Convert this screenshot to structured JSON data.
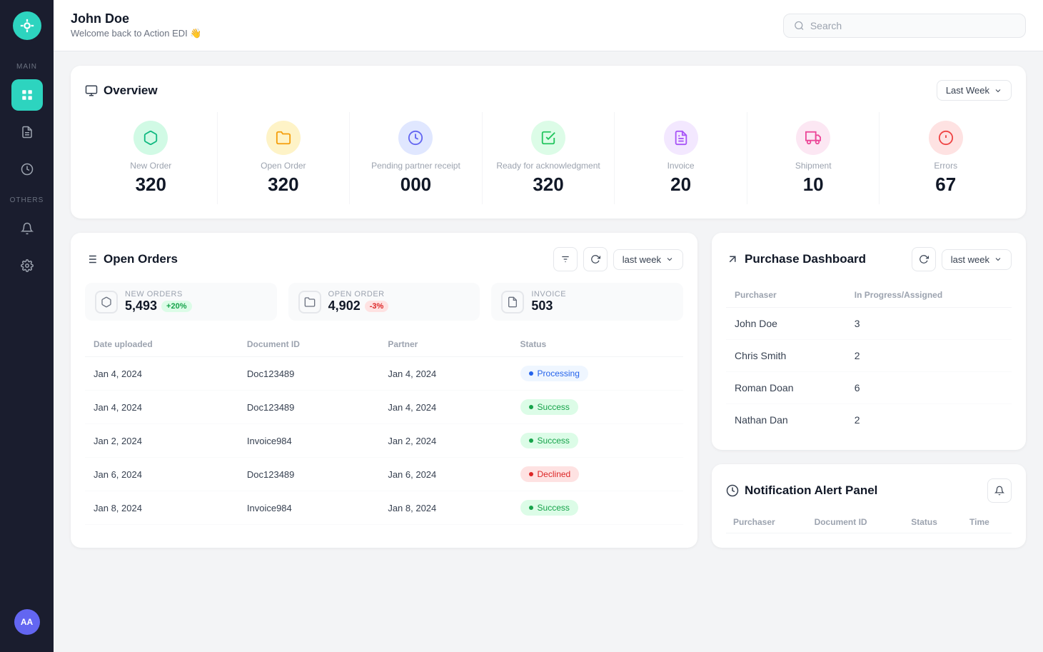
{
  "sidebar": {
    "logo_initials": "AA",
    "sections": {
      "main_label": "MAIN",
      "others_label": "OTHERS"
    },
    "items": [
      {
        "id": "dashboard",
        "label": "Dashboard",
        "active": true
      },
      {
        "id": "documents",
        "label": "Documents",
        "active": false
      },
      {
        "id": "activity",
        "label": "Activity",
        "active": false
      },
      {
        "id": "notifications",
        "label": "Notifications",
        "active": false
      },
      {
        "id": "settings",
        "label": "Settings",
        "active": false
      }
    ]
  },
  "header": {
    "user_name": "John Doe",
    "welcome_message": "Welcome back to Action EDI 👋",
    "search_placeholder": "Search"
  },
  "overview": {
    "title": "Overview",
    "period_label": "Last Week",
    "stats": [
      {
        "id": "new-order",
        "label": "New Order",
        "value": "320",
        "icon_color": "#d1fae5",
        "icon_fg": "#10b981"
      },
      {
        "id": "open-order",
        "label": "Open Order",
        "value": "320",
        "icon_color": "#fef3c7",
        "icon_fg": "#f59e0b"
      },
      {
        "id": "pending-partner",
        "label": "Pending partner receipt",
        "value": "000",
        "icon_color": "#e0e7ff",
        "icon_fg": "#6366f1"
      },
      {
        "id": "ready-ack",
        "label": "Ready for acknowledgment",
        "value": "320",
        "icon_color": "#dcfce7",
        "icon_fg": "#22c55e"
      },
      {
        "id": "invoice",
        "label": "Invoice",
        "value": "20",
        "icon_color": "#f3e8ff",
        "icon_fg": "#a855f7"
      },
      {
        "id": "shipment",
        "label": "Shipment",
        "value": "10",
        "icon_color": "#fce7f3",
        "icon_fg": "#ec4899"
      },
      {
        "id": "errors",
        "label": "Errors",
        "value": "67",
        "icon_color": "#fee2e2",
        "icon_fg": "#ef4444"
      }
    ]
  },
  "open_orders": {
    "title": "Open Orders",
    "period_label": "last week",
    "metrics": [
      {
        "label": "NEW ORDERS",
        "value": "5,493",
        "badge": "+20%",
        "badge_type": "green"
      },
      {
        "label": "OPEN ORDER",
        "value": "4,902",
        "badge": "-3%",
        "badge_type": "red"
      },
      {
        "label": "INVOICE",
        "value": "503"
      }
    ],
    "table": {
      "columns": [
        "Date uploaded",
        "Document ID",
        "Partner",
        "Status"
      ],
      "rows": [
        {
          "date": "Jan 4, 2024",
          "doc_id": "Doc123489",
          "partner": "Jan 4, 2024",
          "status": "Processing",
          "status_type": "processing"
        },
        {
          "date": "Jan 4, 2024",
          "doc_id": "Doc123489",
          "partner": "Jan 4, 2024",
          "status": "Success",
          "status_type": "success"
        },
        {
          "date": "Jan 2, 2024",
          "doc_id": "Invoice984",
          "partner": "Jan 2, 2024",
          "status": "Success",
          "status_type": "success"
        },
        {
          "date": "Jan 6, 2024",
          "doc_id": "Doc123489",
          "partner": "Jan 6, 2024",
          "status": "Declined",
          "status_type": "declined"
        },
        {
          "date": "Jan 8, 2024",
          "doc_id": "Invoice984",
          "partner": "Jan 8, 2024",
          "status": "Success",
          "status_type": "success"
        }
      ]
    }
  },
  "purchase_dashboard": {
    "title": "Purchase Dashboard",
    "period_label": "last week",
    "columns": [
      "Purchaser",
      "In Progress/Assigned"
    ],
    "rows": [
      {
        "purchaser": "John Doe",
        "count": "3"
      },
      {
        "purchaser": "Chris Smith",
        "count": "2"
      },
      {
        "purchaser": "Roman Doan",
        "count": "6"
      },
      {
        "purchaser": "Nathan Dan",
        "count": "2"
      }
    ]
  },
  "notification_panel": {
    "title": "Notification Alert Panel",
    "columns": [
      "Purchaser",
      "Document ID",
      "Status",
      "Time"
    ]
  }
}
